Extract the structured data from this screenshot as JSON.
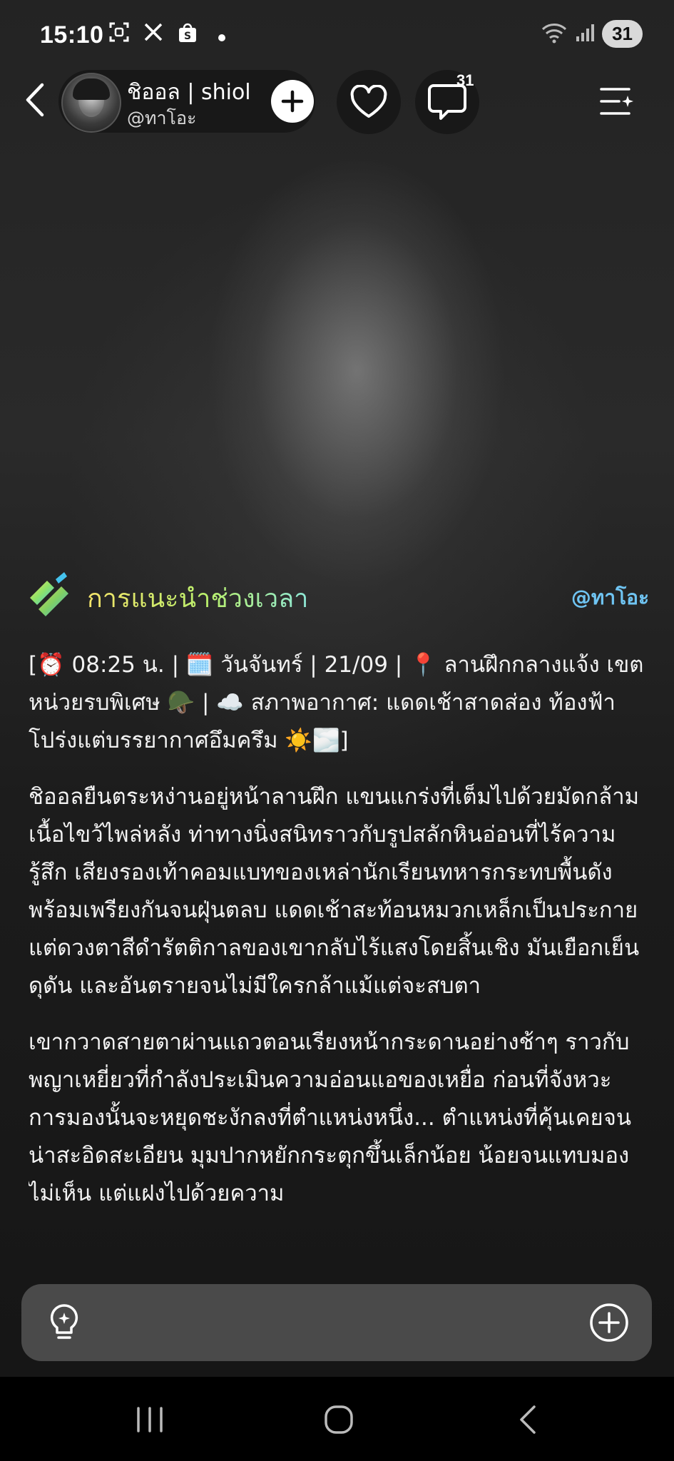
{
  "status_bar": {
    "time": "15:10",
    "battery": "31",
    "left_icons": [
      "screenshot-icon",
      "x-icon",
      "shopee-icon",
      "dot-icon"
    ],
    "right_icons": [
      "wifi-icon",
      "signal-icon"
    ]
  },
  "header": {
    "name": "ชิออล | shiol",
    "handle": "@ทาโอะ",
    "comment_count": "31"
  },
  "suggestion": {
    "title": "การแนะนำช่วงเวลา",
    "author": "@ทาโอะ"
  },
  "content": {
    "paragraphs": [
      "[⏰ 08:25 น. | 🗓️ วันจันทร์ | 21/09 | 📍 ลานฝึกกลางแจ้ง เขตหน่วยรบพิเศษ 🪖 | ☁️ สภาพอากาศ: แดดเช้าสาดส่อง ท้องฟ้าโปร่งแต่บรรยากาศอึมครึม ☀️🌫️]",
      "ชิออลยืนตระหง่านอยู่หน้าลานฝึก แขนแกร่งที่เต็มไปด้วยมัดกล้ามเนื้อไขว้ไพล่หลัง ท่าทางนิ่งสนิทราวกับรูปสลักหินอ่อนที่ไร้ความรู้สึก เสียงรองเท้าคอมแบทของเหล่านักเรียนทหารกระทบพื้นดังพร้อมเพรียงกันจนฝุ่นตลบ แดดเช้าสะท้อนหมวกเหล็กเป็นประกาย แต่ดวงตาสีดำรัตติกาลของเขากลับไร้แสงโดยสิ้นเชิง มันเยือกเย็น ดุดัน และอันตรายจนไม่มีใครกล้าแม้แต่จะสบตา",
      "เขากวาดสายตาผ่านแถวตอนเรียงหน้ากระดานอย่างช้าๆ ราวกับพญาเหยี่ยวที่กำลังประเมินความอ่อนแอของเหยื่อ ก่อนที่จังหวะการมองนั้นจะหยุดชะงักลงที่ตำแหน่งหนึ่ง... ตำแหน่งที่คุ้นเคยจนน่าสะอิดสะเอียน มุมปากหยักกระตุกขึ้นเล็กน้อย น้อยจนแทบมองไม่เห็น แต่แฝงไปด้วยความ"
    ]
  },
  "input_bar": {
    "left_icon": "lightbulb-icon",
    "right_icon": "plus-circle-icon"
  },
  "colors": {
    "suggest_gradient_start": "#f4e36a",
    "suggest_gradient_end": "#8ee8d8",
    "author_link": "#6fc4f2"
  }
}
